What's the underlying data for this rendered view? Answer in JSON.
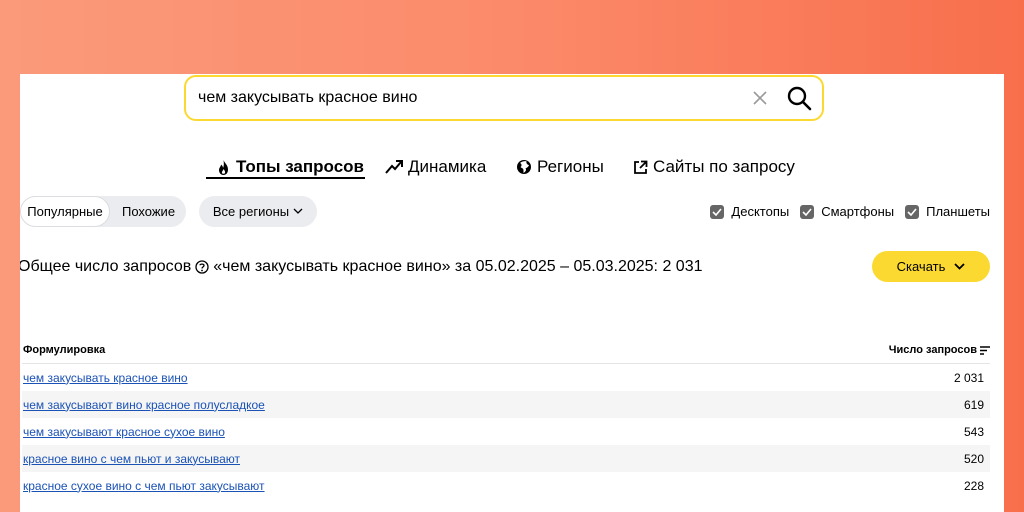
{
  "search": {
    "value": "чем закусывать красное вино"
  },
  "tabs": [
    {
      "label": "Топы запросов",
      "icon": "fire-icon",
      "active": true
    },
    {
      "label": "Динамика",
      "icon": "trend-icon"
    },
    {
      "label": "Регионы",
      "icon": "globe-icon"
    },
    {
      "label": "Сайты по запросу",
      "icon": "external-link-icon"
    }
  ],
  "filters": {
    "popular": "Популярные",
    "similar": "Похожие",
    "regions": "Все регионы",
    "devices": [
      {
        "label": "Десктопы",
        "checked": true
      },
      {
        "label": "Смартфоны",
        "checked": true
      },
      {
        "label": "Планшеты",
        "checked": true
      }
    ]
  },
  "summary": {
    "prefix": "Общее число запросов",
    "text": "«чем закусывать красное вино» за 05.02.2025 – 05.03.2025: 2 031"
  },
  "download_label": "Скачать",
  "table": {
    "columns": [
      "Формулировка",
      "Число запросов"
    ],
    "rows": [
      {
        "phrase": "чем закусывать красное вино",
        "count": "2 031"
      },
      {
        "phrase": "чем закусывают вино красное полусладкое",
        "count": "619"
      },
      {
        "phrase": "чем закусывают красное сухое вино",
        "count": "543"
      },
      {
        "phrase": "красное вино с чем пьют и закусывают",
        "count": "520"
      },
      {
        "phrase": "красное сухое вино с чем пьют закусывают",
        "count": "228"
      }
    ]
  },
  "colors": {
    "accent": "#fcd930",
    "link": "#1b52b5",
    "background_gradient": [
      "#fa9a7a",
      "#f86f4c"
    ]
  }
}
